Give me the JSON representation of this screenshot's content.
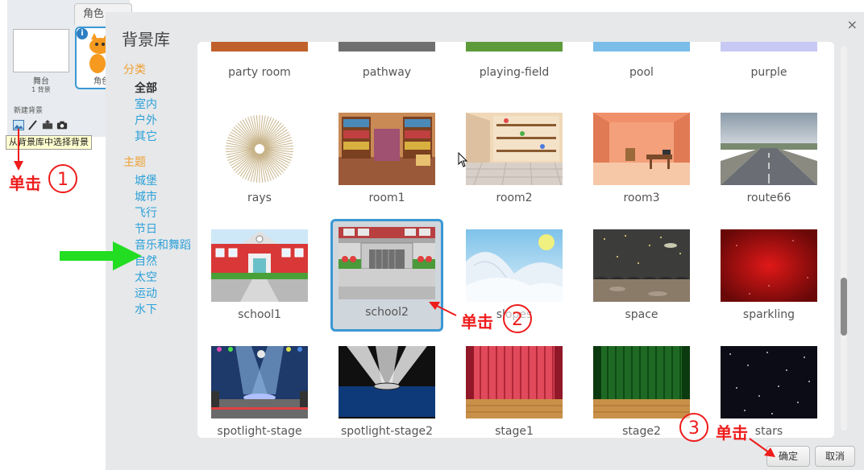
{
  "editor": {
    "sprites_tab": "角色",
    "stage_label": "舞台",
    "stage_sub": "1 背景",
    "new_backdrop_label": "新建背景",
    "sprite_name": "角色",
    "tooltip": "从背景库中选择背景"
  },
  "annotations": {
    "step1_text": "单击",
    "step1_num": "1",
    "step2_text": "单击",
    "step2_num": "2",
    "step3_text": "单击",
    "step3_num": "3"
  },
  "dialog": {
    "title": "背景库",
    "close_glyph": "×",
    "category_head": "分类",
    "categories": [
      "全部",
      "室内",
      "户外",
      "其它"
    ],
    "theme_head": "主题",
    "themes": [
      "城堡",
      "城市",
      "飞行",
      "节日",
      "音乐和舞蹈",
      "自然",
      "太空",
      "运动",
      "水下"
    ],
    "ok_label": "确定",
    "cancel_label": "取消"
  },
  "backdrops": {
    "top_row": [
      "party room",
      "pathway",
      "playing-field",
      "pool",
      "purple"
    ],
    "row1": [
      "rays",
      "room1",
      "room2",
      "room3",
      "route66"
    ],
    "row2": [
      "school1",
      "school2",
      "slopes",
      "space",
      "sparkling"
    ],
    "row3": [
      "spotlight-stage",
      "spotlight-stage2",
      "stage1",
      "stage2",
      "stars"
    ],
    "selected": "school2"
  },
  "colors": {
    "accent": "#3a98d4",
    "annotation": "#ee1c1c",
    "category_head": "#f0a030",
    "category_link": "#2ba0d8",
    "green_arrow": "#22dd22"
  }
}
